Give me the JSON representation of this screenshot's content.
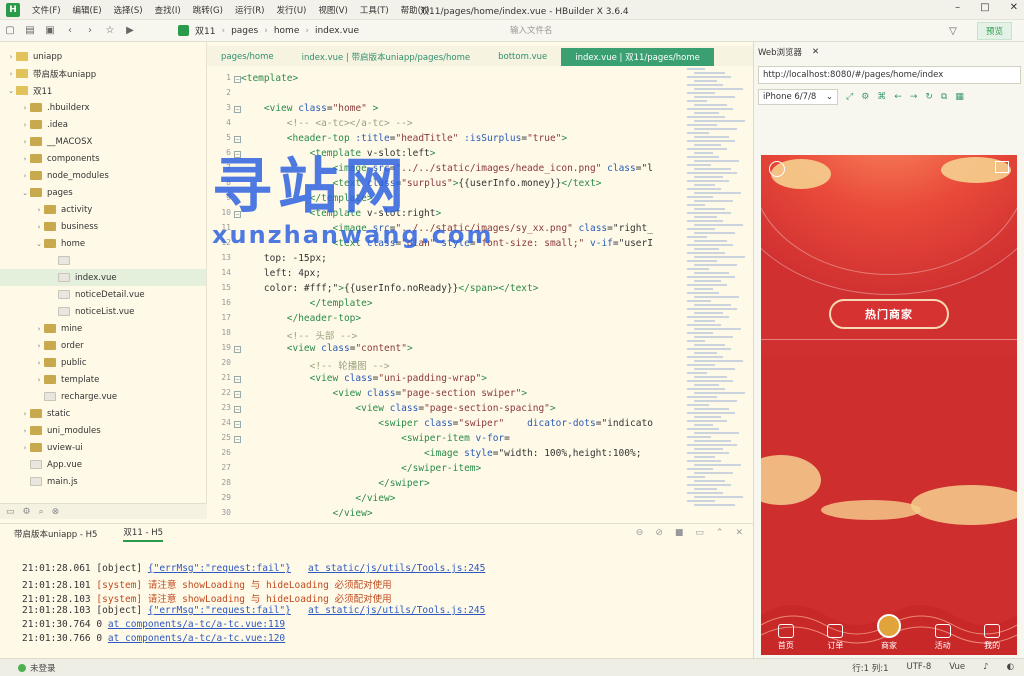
{
  "app": {
    "window_title": "双11/pages/home/index.vue - HBuilder X 3.6.4",
    "menus": [
      "文件(F)",
      "编辑(E)",
      "选择(S)",
      "查找(I)",
      "跳转(G)",
      "运行(R)",
      "发行(U)",
      "视图(V)",
      "工具(T)",
      "帮助(Y)"
    ],
    "logo": "H",
    "window_controls": [
      "–",
      "□",
      "✕"
    ]
  },
  "toolbar": {
    "breadcrumb": [
      "双11",
      "pages",
      "home",
      "index.vue"
    ],
    "file_search_placeholder": "输入文件名",
    "preview_label": "预览"
  },
  "sidebar": {
    "items": [
      {
        "label": "uniapp",
        "type": "project",
        "level": 0,
        "caret": "›"
      },
      {
        "label": "带启版本uniapp",
        "type": "project",
        "level": 0,
        "caret": "›"
      },
      {
        "label": "双11",
        "type": "project",
        "level": 0,
        "caret": "⌄"
      },
      {
        "label": ".hbuilderx",
        "type": "folder",
        "level": 1,
        "caret": "›"
      },
      {
        "label": ".idea",
        "type": "folder",
        "level": 1,
        "caret": "›"
      },
      {
        "label": "__MACOSX",
        "type": "folder",
        "level": 1,
        "caret": "›"
      },
      {
        "label": "components",
        "type": "folder",
        "level": 1,
        "caret": "›"
      },
      {
        "label": "node_modules",
        "type": "folder",
        "level": 1,
        "caret": "›"
      },
      {
        "label": "pages",
        "type": "folder",
        "level": 1,
        "caret": "⌄"
      },
      {
        "label": "activity",
        "type": "folder",
        "level": 2,
        "caret": "›"
      },
      {
        "label": "business",
        "type": "folder",
        "level": 2,
        "caret": "›"
      },
      {
        "label": "home",
        "type": "folder",
        "level": 2,
        "caret": "⌄"
      },
      {
        "label": "",
        "type": "file",
        "level": 3,
        "caret": ""
      },
      {
        "label": "index.vue",
        "type": "file",
        "level": 3,
        "caret": "",
        "selected": true
      },
      {
        "label": "noticeDetail.vue",
        "type": "file",
        "level": 3,
        "caret": ""
      },
      {
        "label": "noticeList.vue",
        "type": "file",
        "level": 3,
        "caret": ""
      },
      {
        "label": "mine",
        "type": "folder",
        "level": 2,
        "caret": "›"
      },
      {
        "label": "order",
        "type": "folder",
        "level": 2,
        "caret": "›"
      },
      {
        "label": "public",
        "type": "folder",
        "level": 2,
        "caret": "›"
      },
      {
        "label": "template",
        "type": "folder",
        "level": 2,
        "caret": "›"
      },
      {
        "label": "recharge.vue",
        "type": "file",
        "level": 2,
        "caret": ""
      },
      {
        "label": "static",
        "type": "folder",
        "level": 1,
        "caret": "›"
      },
      {
        "label": "uni_modules",
        "type": "folder",
        "level": 1,
        "caret": "›"
      },
      {
        "label": "uview-ui",
        "type": "folder",
        "level": 1,
        "caret": "›"
      },
      {
        "label": "App.vue",
        "type": "file",
        "level": 1,
        "caret": ""
      },
      {
        "label": "main.js",
        "type": "file",
        "level": 1,
        "caret": ""
      }
    ]
  },
  "editor": {
    "tabs": [
      {
        "label": "pages/home",
        "active": false
      },
      {
        "label": "index.vue | 带启版本uniapp/pages/home",
        "active": false
      },
      {
        "label": "bottom.vue",
        "active": false
      },
      {
        "label": "index.vue | 双11/pages/home",
        "active": true
      }
    ],
    "lines": [
      {
        "n": "1",
        "fold": true,
        "text": "<template>"
      },
      {
        "n": "2",
        "fold": false,
        "text": ""
      },
      {
        "n": "3",
        "fold": true,
        "text": "    <view class=\"home\" >"
      },
      {
        "n": "4",
        "fold": false,
        "text": "        <!-- <a-tc></a-tc> -->"
      },
      {
        "n": "5",
        "fold": true,
        "text": "        <header-top :title=\"headTitle\" :isSurplus=\"true\">"
      },
      {
        "n": "6",
        "fold": true,
        "text": "            <template v-slot:left>"
      },
      {
        "n": "7",
        "fold": false,
        "text": "                <image src=\"../../static/images/heade_icon.png\" class=\"l"
      },
      {
        "n": "8",
        "fold": false,
        "text": "                <text class=\"surplus\">{{userInfo.money}}</text>"
      },
      {
        "n": "9",
        "fold": false,
        "text": "            </template>"
      },
      {
        "n": "10",
        "fold": true,
        "text": "            <template v-slot:right>"
      },
      {
        "n": "11",
        "fold": false,
        "text": "                <image src=\"../../static/images/sy_xx.png\" class=\"right_"
      },
      {
        "n": "12",
        "fold": false,
        "text": "                <text class=\"dian\" style=\"font-size: small;\" v-if=\"userI"
      },
      {
        "n": "13",
        "fold": false,
        "text": "    top: -15px;"
      },
      {
        "n": "14",
        "fold": false,
        "text": "    left: 4px;"
      },
      {
        "n": "15",
        "fold": false,
        "text": "    color: #fff;\">{{userInfo.noReady}}</span></text>"
      },
      {
        "n": "16",
        "fold": false,
        "text": "            </template>"
      },
      {
        "n": "17",
        "fold": false,
        "text": "        </header-top>"
      },
      {
        "n": "18",
        "fold": false,
        "text": "        <!-- 头部 -->"
      },
      {
        "n": "19",
        "fold": true,
        "text": "        <view class=\"content\">"
      },
      {
        "n": "20",
        "fold": false,
        "text": "            <!-- 轮播图 -->"
      },
      {
        "n": "21",
        "fold": true,
        "text": "            <view class=\"uni-padding-wrap\">"
      },
      {
        "n": "22",
        "fold": true,
        "text": "                <view class=\"page-section swiper\">"
      },
      {
        "n": "23",
        "fold": true,
        "text": "                    <view class=\"page-section-spacing\">"
      },
      {
        "n": "24",
        "fold": true,
        "text": "                        <swiper class=\"swiper\"    dicator-dots=\"indicato"
      },
      {
        "n": "25",
        "fold": true,
        "text": "                            <swiper-item v-for="
      },
      {
        "n": "26",
        "fold": false,
        "text": "                                <image style=\"width: 100%,height:100%;"
      },
      {
        "n": "27",
        "fold": false,
        "text": "                            </swiper-item>"
      },
      {
        "n": "28",
        "fold": false,
        "text": "                        </swiper>"
      },
      {
        "n": "29",
        "fold": false,
        "text": "                    </view>"
      },
      {
        "n": "30",
        "fold": false,
        "text": "                </view>"
      }
    ]
  },
  "watermark": {
    "big": "寻站网",
    "small": "xunzhanwang.com"
  },
  "console": {
    "tabs": [
      {
        "label": "带启版本uniapp - H5",
        "active": false
      },
      {
        "label": "双11 - H5",
        "active": true
      }
    ],
    "logs": [
      {
        "time": "21:01:28.061",
        "prefix": "[object]",
        "msg": "{\"errMsg\":\"request:fail\"}",
        "loc": "at static/js/utils/Tools.js:245",
        "kind": "obj"
      },
      {
        "time": "21:01:28.101",
        "prefix": "[system]",
        "msg": "请注意 showLoading 与 hideLoading 必须配对使用",
        "loc": "",
        "kind": "sys"
      },
      {
        "time": "21:01:28.103",
        "prefix": "[system]",
        "msg": "请注意 showLoading 与 hideLoading 必须配对使用",
        "loc": "",
        "kind": "sys"
      },
      {
        "time": "21:01:28.103",
        "prefix": "[object]",
        "msg": "{\"errMsg\":\"request:fail\"}",
        "loc": "at static/js/utils/Tools.js:245",
        "kind": "obj"
      },
      {
        "time": "21:01:30.764",
        "prefix": "0",
        "msg": "",
        "loc": "at components/a-tc/a-tc.vue:119",
        "kind": "num"
      },
      {
        "time": "21:01:30.766",
        "prefix": "0",
        "msg": "",
        "loc": "at components/a-tc/a-tc.vue:120",
        "kind": "num"
      }
    ]
  },
  "statusbar": {
    "login": "未登录",
    "position": "行:1  列:1",
    "encoding": "UTF-8",
    "language": "Vue"
  },
  "browser": {
    "tab_label": "Web浏览器",
    "url": "http://localhost:8080/#/pages/home/index",
    "device": "iPhone 6/7/8",
    "hot_button": "热门商家",
    "tabs": [
      "首页",
      "订单",
      "商家",
      "活动",
      "我的"
    ]
  },
  "colors": {
    "accent": "#2a9b4a",
    "phone_red": "#cf2e2e",
    "cloud_gold": "#f6cf8f"
  }
}
